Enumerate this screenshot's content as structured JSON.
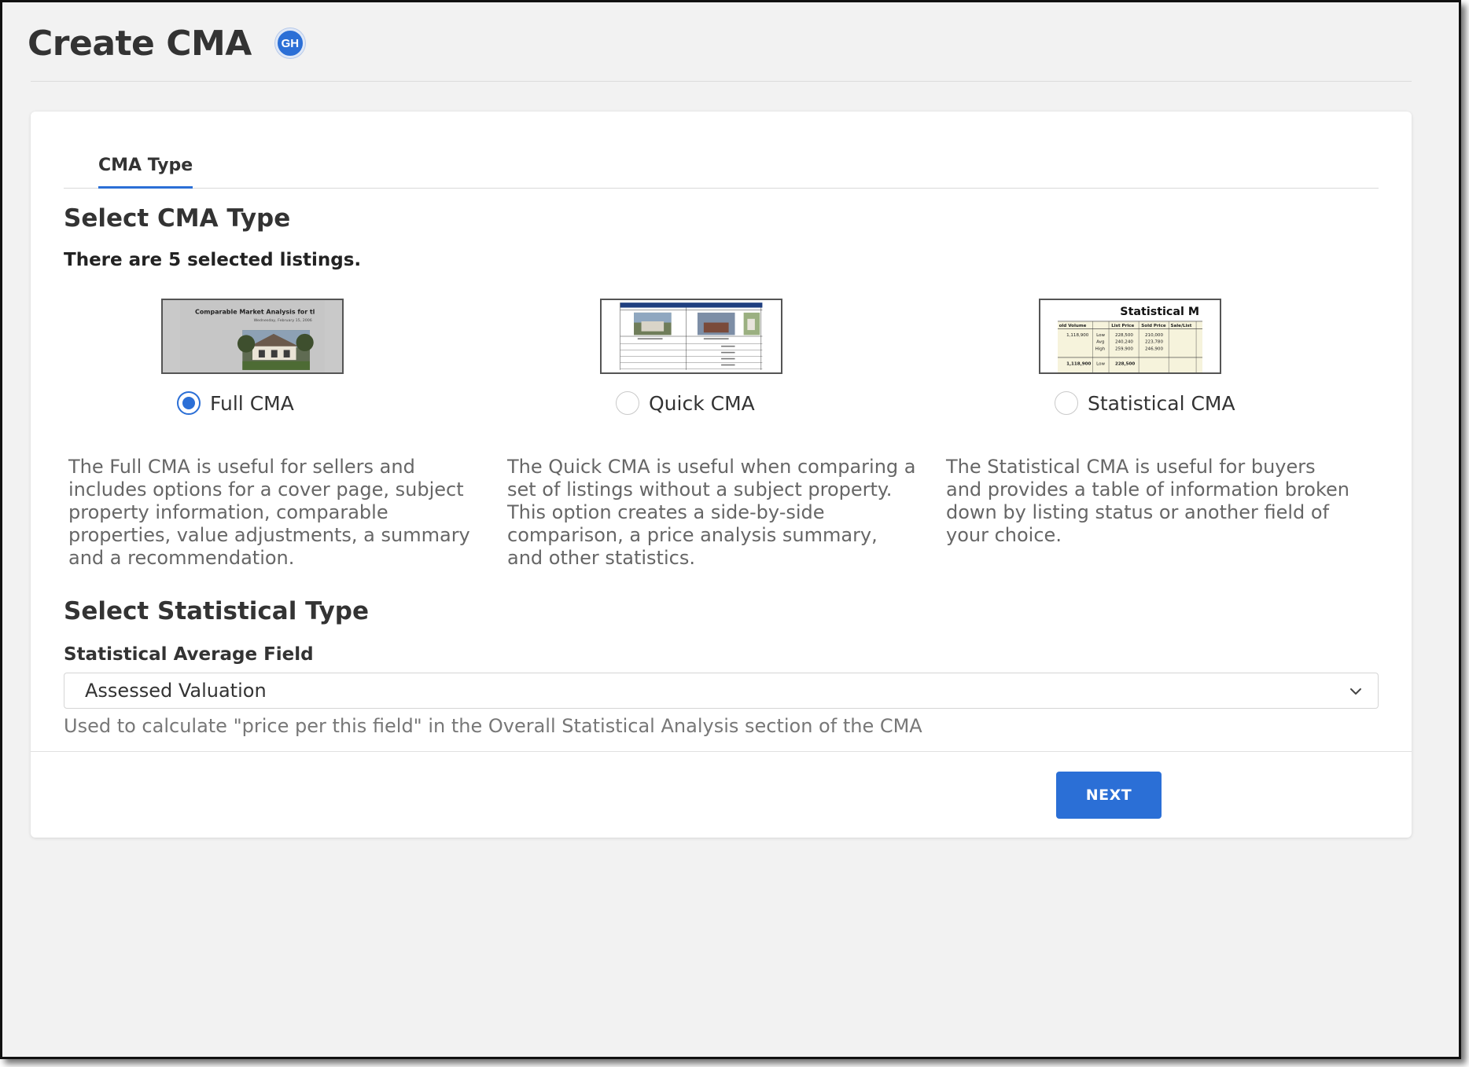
{
  "page": {
    "title": "Create CMA",
    "user_initials": "GH"
  },
  "tabs": [
    {
      "label": "CMA Type",
      "active": true
    }
  ],
  "cma_type": {
    "heading": "Select CMA Type",
    "listing_count_text": "There are 5 selected listings.",
    "options": [
      {
        "label": "Full CMA",
        "selected": true,
        "description": "The Full CMA is useful for sellers and includes options for a cover page, subject property information, comparable properties, value adjustments, a summary and a recommendation.",
        "thumb_title": "Comparable Market Analysis for tl",
        "thumb_date": "Wednesday, February 15, 2006"
      },
      {
        "label": "Quick CMA",
        "selected": false,
        "description": "The Quick CMA is useful when comparing a set of listings without a subject property. This option creates a side-by-side comparison, a price analysis summary, and other statistics."
      },
      {
        "label": "Statistical CMA",
        "selected": false,
        "description": "The Statistical CMA is useful for buyers and provides a table of information broken down by listing status or another field of your choice.",
        "thumb_title": "Statistical M",
        "thumb_headers": [
          "old Volume",
          "",
          "List Price",
          "Sold Price",
          "Sale/List"
        ],
        "thumb_rows": [
          [
            "1,118,900",
            "Low",
            "228,500",
            "210,000"
          ],
          [
            "",
            "Avg",
            "240,240",
            "223,780"
          ],
          [
            "",
            "High",
            "259,900",
            "246,900"
          ],
          [
            "1,118,900",
            "Low",
            "228,500",
            ""
          ]
        ]
      }
    ]
  },
  "statistical": {
    "heading": "Select Statistical Type",
    "field_label": "Statistical Average Field",
    "selected_value": "Assessed Valuation",
    "help_text": "Used to calculate \"price per this field\" in the Overall Statistical Analysis section of the CMA"
  },
  "footer": {
    "next_label": "NEXT"
  },
  "colors": {
    "accent": "#2b6fd6",
    "page_bg": "#f2f2f2",
    "card_bg": "#ffffff"
  }
}
